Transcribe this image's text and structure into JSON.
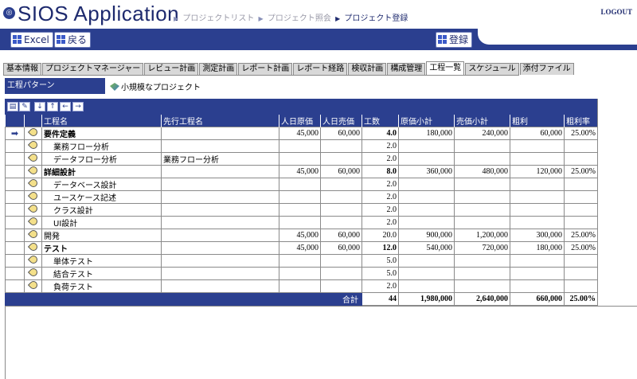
{
  "header": {
    "app_title": "SIOS Application",
    "breadcrumb": [
      "プロジェクトリスト",
      "プロジェクト照会",
      "プロジェクト登録"
    ],
    "logout": "LOGOUT"
  },
  "toolbar": {
    "excel_label": "Excel",
    "back_label": "戻る",
    "register_label": "登録"
  },
  "tabs": [
    "基本情報",
    "プロジェクトマネージャー",
    "レビュー計画",
    "測定計画",
    "レポート計画",
    "レポート経路",
    "検収計画",
    "構成管理",
    "工程一覧",
    "スケジュール",
    "添付ファイル"
  ],
  "active_tab": "工程一覧",
  "pattern": {
    "label": "工程パターン",
    "link": "小規模なプロジェクト"
  },
  "grid_tools": [
    "table-icon",
    "edit-icon",
    "down-arrow-icon",
    "up-arrow-icon",
    "left-arrow-icon",
    "right-arrow-icon"
  ],
  "columns": [
    "工程名",
    "先行工程名",
    "人日原価",
    "人日売価",
    "工数",
    "原価小計",
    "売価小計",
    "粗利",
    "粗利率"
  ],
  "rows": [
    {
      "name": "要件定義",
      "pred": "",
      "cost": "45,000",
      "price": "60,000",
      "hours": "4.0",
      "cost_sub": "180,000",
      "price_sub": "240,000",
      "profit": "60,000",
      "rate": "25.00%",
      "level": 0,
      "bold": true,
      "current": true
    },
    {
      "name": "業務フロー分析",
      "pred": "",
      "cost": "",
      "price": "",
      "hours": "2.0",
      "cost_sub": "",
      "price_sub": "",
      "profit": "",
      "rate": "",
      "level": 1,
      "bold": false,
      "current": false
    },
    {
      "name": "データフロー分析",
      "pred": "業務フロー分析",
      "cost": "",
      "price": "",
      "hours": "2.0",
      "cost_sub": "",
      "price_sub": "",
      "profit": "",
      "rate": "",
      "level": 1,
      "bold": false,
      "current": false
    },
    {
      "name": "詳細設計",
      "pred": "",
      "cost": "45,000",
      "price": "60,000",
      "hours": "8.0",
      "cost_sub": "360,000",
      "price_sub": "480,000",
      "profit": "120,000",
      "rate": "25.00%",
      "level": 0,
      "bold": true,
      "current": false
    },
    {
      "name": "データベース設計",
      "pred": "",
      "cost": "",
      "price": "",
      "hours": "2.0",
      "cost_sub": "",
      "price_sub": "",
      "profit": "",
      "rate": "",
      "level": 1,
      "bold": false,
      "current": false
    },
    {
      "name": "ユースケース記述",
      "pred": "",
      "cost": "",
      "price": "",
      "hours": "2.0",
      "cost_sub": "",
      "price_sub": "",
      "profit": "",
      "rate": "",
      "level": 1,
      "bold": false,
      "current": false
    },
    {
      "name": "クラス設計",
      "pred": "",
      "cost": "",
      "price": "",
      "hours": "2.0",
      "cost_sub": "",
      "price_sub": "",
      "profit": "",
      "rate": "",
      "level": 1,
      "bold": false,
      "current": false
    },
    {
      "name": "UI設計",
      "pred": "",
      "cost": "",
      "price": "",
      "hours": "2.0",
      "cost_sub": "",
      "price_sub": "",
      "profit": "",
      "rate": "",
      "level": 1,
      "bold": false,
      "current": false
    },
    {
      "name": "開発",
      "pred": "",
      "cost": "45,000",
      "price": "60,000",
      "hours": "20.0",
      "cost_sub": "900,000",
      "price_sub": "1,200,000",
      "profit": "300,000",
      "rate": "25.00%",
      "level": 0,
      "bold": false,
      "current": false
    },
    {
      "name": "テスト",
      "pred": "",
      "cost": "45,000",
      "price": "60,000",
      "hours": "12.0",
      "cost_sub": "540,000",
      "price_sub": "720,000",
      "profit": "180,000",
      "rate": "25.00%",
      "level": 0,
      "bold": true,
      "current": false
    },
    {
      "name": "単体テスト",
      "pred": "",
      "cost": "",
      "price": "",
      "hours": "5.0",
      "cost_sub": "",
      "price_sub": "",
      "profit": "",
      "rate": "",
      "level": 1,
      "bold": false,
      "current": false
    },
    {
      "name": "結合テスト",
      "pred": "",
      "cost": "",
      "price": "",
      "hours": "5.0",
      "cost_sub": "",
      "price_sub": "",
      "profit": "",
      "rate": "",
      "level": 1,
      "bold": false,
      "current": false
    },
    {
      "name": "負荷テスト",
      "pred": "",
      "cost": "",
      "price": "",
      "hours": "2.0",
      "cost_sub": "",
      "price_sub": "",
      "profit": "",
      "rate": "",
      "level": 1,
      "bold": false,
      "current": false
    }
  ],
  "totals": {
    "label": "合計",
    "hours": "44",
    "cost_sub": "1,980,000",
    "price_sub": "2,640,000",
    "profit": "660,000",
    "rate": "25.00%"
  },
  "colors": {
    "primary": "#2b3f8f",
    "tab_bg": "#d8d8d8"
  }
}
